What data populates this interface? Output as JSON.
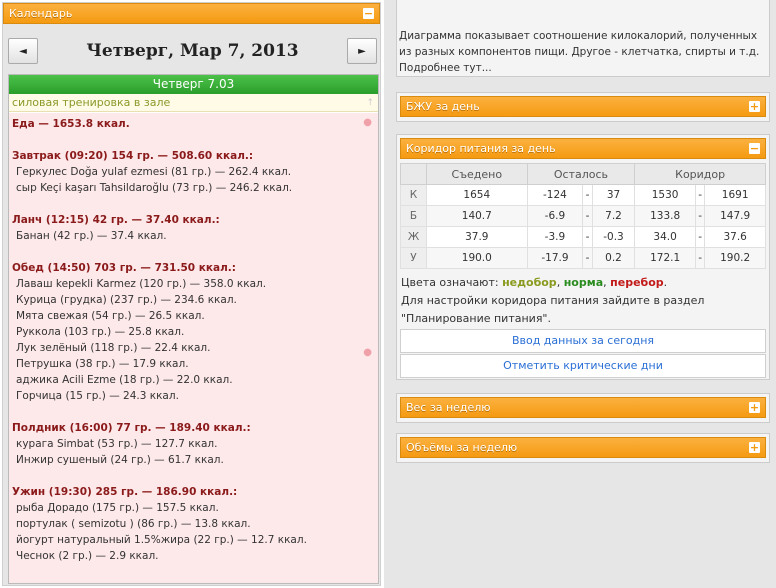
{
  "calendar": {
    "title": "Календарь",
    "toggle": "−",
    "prev": "◄",
    "next": "►",
    "date": "Четверг, Мар 7, 2013",
    "day_header": "Четверг 7.03",
    "workout": "силовая тренировка в зале",
    "food_total": "Еда — 1653.8 ккал.",
    "meals": [
      {
        "title": "Завтрак (09:20) 154 гр. — 508.60 ккал.:",
        "items": [
          "Геркулес Doğa yulaf ezmesi (81 гр.) — 262.4 ккал.",
          "сыр Keçi kaşarı Tahsildaroğlu (73 гр.) — 246.2 ккал."
        ]
      },
      {
        "title": "Ланч (12:15) 42 гр. — 37.40 ккал.:",
        "items": [
          "Банан (42 гр.) — 37.4 ккал."
        ]
      },
      {
        "title": "Обед (14:50) 703 гр. — 731.50 ккал.:",
        "items": [
          "Лаваш kepekli Karmez (120 гр.) — 358.0 ккал.",
          "Курица (грудка) (237 гр.) — 234.6 ккал.",
          "Мята свежая (54 гр.) — 26.5 ккал.",
          "Руккола (103 гр.) — 25.8 ккал.",
          "Лук зелёный (118 гр.) — 22.4 ккал.",
          "Петрушка (38 гр.) — 17.9 ккал.",
          "аджика Acili Ezme (18 гр.) — 22.0 ккал.",
          "Горчица (15 гр.) — 24.3 ккал."
        ]
      },
      {
        "title": "Полдник (16:00) 77 гр. — 189.40 ккал.:",
        "items": [
          "курага Simbat (53 гр.) — 127.7 ккал.",
          "Инжир сушеный (24 гр.) — 61.7 ккал."
        ]
      },
      {
        "title": "Ужин (19:30) 285 гр. — 186.90 ккал.:",
        "items": [
          "рыба Дорадо (175 гр.) — 157.5 ккал.",
          "портулак ( semizotu ) (86 гр.) — 13.8 ккал.",
          "йогурт натуральный 1.5%жира (22 гр.) — 12.7 ккал.",
          "Чеснок (2 гр.) — 2.9 ккал."
        ]
      }
    ]
  },
  "description": {
    "text": "Диаграмма показывает соотношение килокалорий, полученных из разных компонентов пищи. Другое - клетчатка, спирты и т.д.",
    "more": "Подробнее тут..."
  },
  "bju": {
    "title": "БЖУ за день",
    "toggle": "+"
  },
  "corridor": {
    "title": "Коридор питания за день",
    "toggle": "−",
    "headers": [
      "Съедено",
      "Осталось",
      "Коридор"
    ],
    "rows": [
      {
        "label": "К",
        "eaten": "1654",
        "status": "green",
        "left_min": "-124",
        "left_max": "37",
        "cor_min": "1530",
        "cor_max": "1691"
      },
      {
        "label": "Б",
        "eaten": "140.7",
        "status": "green",
        "left_min": "-6.9",
        "left_max": "7.2",
        "cor_min": "133.8",
        "cor_max": "147.9"
      },
      {
        "label": "Ж",
        "eaten": "37.9",
        "status": "red",
        "left_min": "-3.9",
        "left_max": "-0.3",
        "cor_min": "34.0",
        "cor_max": "37.6"
      },
      {
        "label": "У",
        "eaten": "190.0",
        "status": "green",
        "left_min": "-17.9",
        "left_max": "0.2",
        "cor_min": "172.1",
        "cor_max": "190.2"
      }
    ],
    "dash": "-",
    "legend_prefix": "Цвета означают:",
    "legend_under": "недобор",
    "legend_norm": "норма",
    "legend_over": "перебор",
    "comma": ",",
    "period": ".",
    "settings_text": "Для настройки коридора питания зайдите в раздел \"Планирование питания\".",
    "btn_today": "Ввод данных за сегодня",
    "btn_critical": "Отметить критические дни",
    "colors": {
      "under": "#8a9a1e",
      "norm": "#2a8c1f",
      "over": "#c21a1a"
    }
  },
  "weight": {
    "title": "Вес за неделю",
    "toggle": "+"
  },
  "volumes": {
    "title": "Объёмы за неделю",
    "toggle": "+"
  }
}
